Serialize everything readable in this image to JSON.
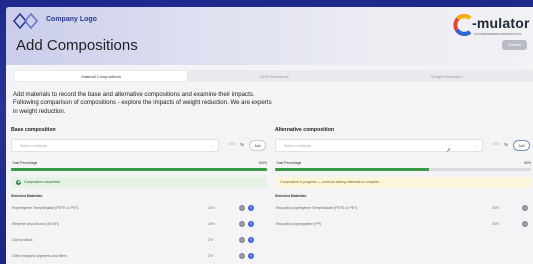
{
  "header": {
    "logo_text": "Company Logo",
    "title": "Add Compositions",
    "brand": "-mulator",
    "brand_sub": "A FUTURE RESEARCH INNOVATION CO.",
    "top_button": "Simulate"
  },
  "tabs": [
    {
      "label": "Material Compositions",
      "active": true
    },
    {
      "label": "GHG Emissions",
      "active": false
    },
    {
      "label": "Weight Reduction",
      "active": false
    }
  ],
  "intro": "Add materials to record the base and alternative compositions and examine their impacts. Following comparison of compositions - explore the impacts of weight reduction. We are experts in weight reduction.",
  "base": {
    "title": "Base composition",
    "select_placeholder": "Select a material",
    "pct_placeholder": "000",
    "pct_sign": "%",
    "add_label": "Add",
    "total_label": "Total Percentage",
    "total_value": "100%",
    "total_fraction": 1.0,
    "status": "Composition completed!",
    "selected_title": "Selected Materials",
    "materials": [
      {
        "name": "Polyethylene Terephthalate (PETE or PET)",
        "pct": "30%"
      },
      {
        "name": "Ethylene vinyl alcohol (EVOH)",
        "pct": "40%"
      },
      {
        "name": "Carbon black",
        "pct": "2%"
      },
      {
        "name": "Other inorganic pigments and fillers",
        "pct": "2%"
      }
    ]
  },
  "alt": {
    "title": "Alternative composition",
    "select_placeholder": "Select a material",
    "pct_placeholder": "000",
    "pct_sign": "%",
    "add_label": "Add",
    "total_label": "Total Percentage",
    "total_value": "60%",
    "total_fraction": 0.6,
    "status": "Composition in progress — continue adding materials to complete.",
    "selected_title": "Selected Materials",
    "materials": [
      {
        "name": "Recycled polyethylene Terephthalate (PETE or PET)",
        "pct": "30%"
      },
      {
        "name": "Recycled polypropylene (PP)",
        "pct": "30%"
      }
    ]
  },
  "colors": {
    "accent": "#2b3990",
    "progress": "#3a9a4a",
    "action": "#3f66d6"
  }
}
